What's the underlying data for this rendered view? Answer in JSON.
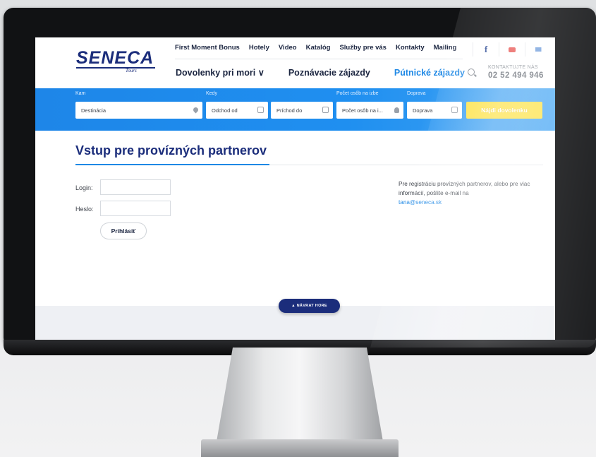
{
  "brand": {
    "logo": "SENECA",
    "logo_sub": "Tours"
  },
  "topnav": [
    "First Moment Bonus",
    "Hotely",
    "Video",
    "Katalóg",
    "Služby pre vás",
    "Kontakty",
    "Mailing"
  ],
  "social": {
    "facebook": "f"
  },
  "mainnav": {
    "item1": "Dovolenky pri mori ∨",
    "item2": "Poznávacie zájazdy",
    "item3": "Pútnické zájazdy"
  },
  "contact": {
    "label": "KONTAKTUJTE NÁS",
    "phone": "02 52 494 946"
  },
  "search": {
    "labels": {
      "kam": "Kam",
      "kedy": "Kedy",
      "osoby": "Počet osôb na izbe",
      "doprava": "Doprava"
    },
    "fields": {
      "destinacia": "Destinácia",
      "odchod": "Odchod od",
      "prichod": "Príchod do",
      "osoby": "Počet osôb na i...",
      "doprava": "Doprava"
    },
    "button": "Nájdi dovolenku"
  },
  "page": {
    "title": "Vstup pre provízných partnerov",
    "login_label": "Login:",
    "password_label": "Heslo:",
    "login_button": "Prihlásiť",
    "info_text": "Pre registráciu provízných partnerov, alebo pre viac informácií, pošlite e-mail na",
    "info_email": "tana@seneca.sk"
  },
  "footer": {
    "back_to_top": "▲ NÁVRAT HORE"
  },
  "colors": {
    "brand_navy": "#1b2d7b",
    "accent_blue": "#1e88e5",
    "cta_yellow": "#fde03a"
  }
}
